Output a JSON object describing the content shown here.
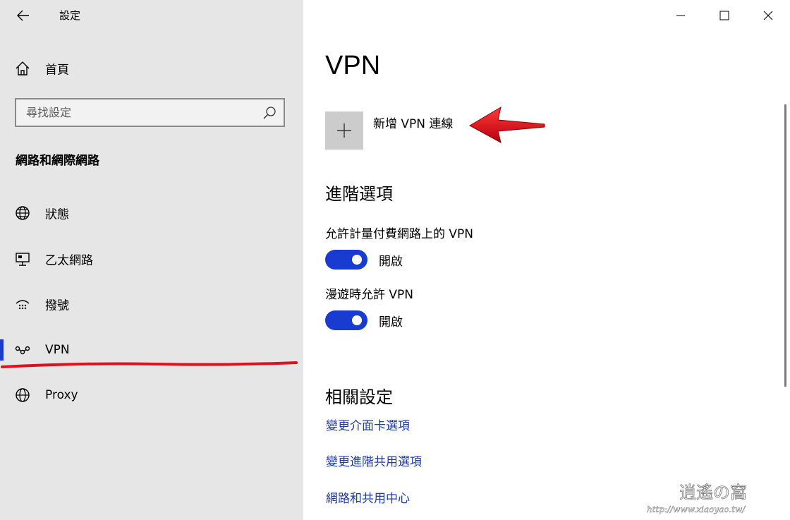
{
  "app": {
    "title": "設定"
  },
  "sidebar": {
    "home_label": "首頁",
    "search_placeholder": "尋找設定",
    "section_heading": "網路和網際網路",
    "items": [
      {
        "label": "狀態",
        "icon": "globe-status-icon"
      },
      {
        "label": "乙太網路",
        "icon": "ethernet-icon"
      },
      {
        "label": "撥號",
        "icon": "dialup-icon"
      },
      {
        "label": "VPN",
        "icon": "vpn-icon",
        "selected": true
      },
      {
        "label": "Proxy",
        "icon": "globe-icon"
      }
    ]
  },
  "main": {
    "title": "VPN",
    "add_vpn_label": "新增 VPN 連線",
    "advanced_heading": "進階選項",
    "options": [
      {
        "label": "允許計量付費網路上的 VPN",
        "state": "開啟",
        "on": true
      },
      {
        "label": "漫遊時允許 VPN",
        "state": "開啟",
        "on": true
      }
    ],
    "related_heading": "相關設定",
    "links": [
      "變更介面卡選項",
      "變更進階共用選項",
      "網路和共用中心"
    ]
  },
  "watermark": {
    "text": "逍遙の窩",
    "url": "http://www.xiaoyao.tw/"
  },
  "colors": {
    "accent": "#1a3bd0",
    "link": "#1a3bb5",
    "sidebar_bg": "#e6e6e6",
    "annotation_red": "#e01020"
  }
}
